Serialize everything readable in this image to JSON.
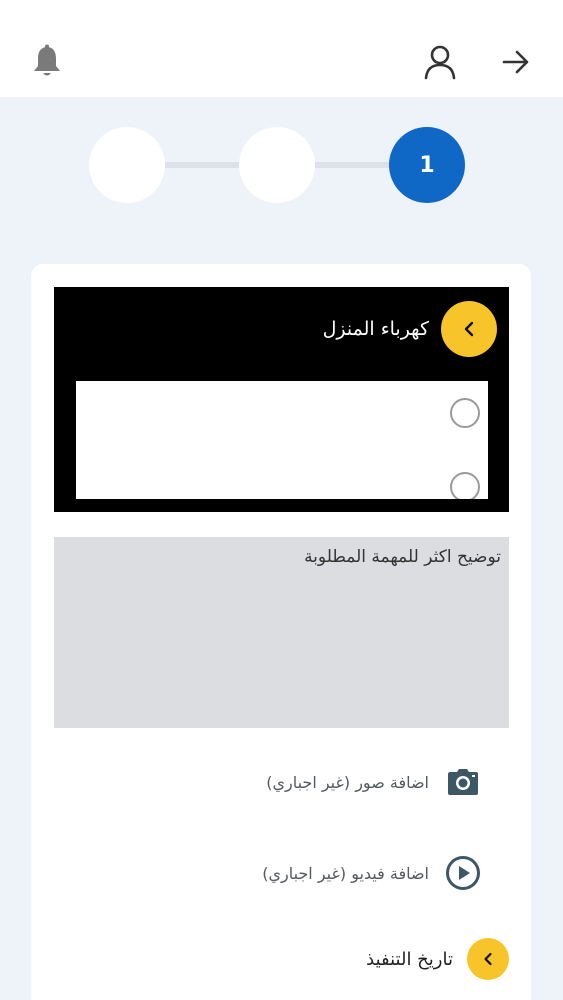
{
  "header": {
    "icons": [
      "bell-icon",
      "user-icon",
      "arrow-right-icon"
    ]
  },
  "stepper": {
    "steps": [
      {
        "label": "1",
        "state": "active"
      },
      {
        "label": "",
        "state": "inactive"
      },
      {
        "label": "",
        "state": "inactive"
      }
    ],
    "active_color": "#0f67c6"
  },
  "category": {
    "title": "كهرباء المنزل",
    "back_icon": "chevron-left-icon"
  },
  "description": {
    "placeholder": "توضيح اكثر للمهمة المطلوبة"
  },
  "attachments": {
    "photos_label": "اضافة صور (غير اجباري)",
    "video_label": "اضافة فيديو (غير اجباري)"
  },
  "execution_date": {
    "label": "تاريخ التنفيذ"
  },
  "colors": {
    "accent_yellow": "#f7c52a",
    "primary_blue": "#0f67c6",
    "background": "#eef2f9"
  }
}
